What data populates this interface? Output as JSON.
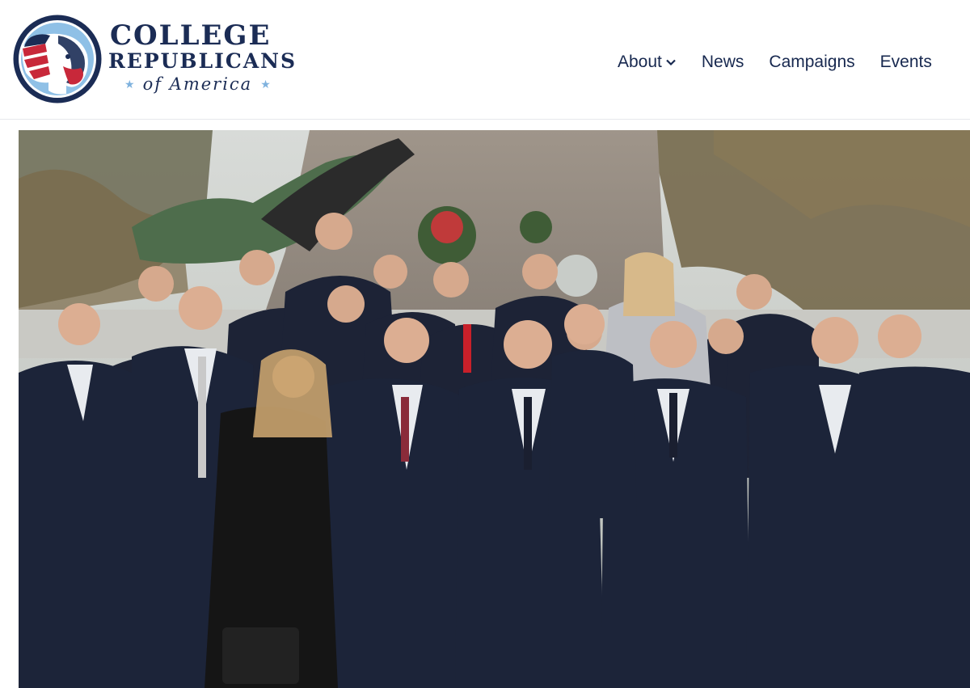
{
  "brand": {
    "line1": "COLLEGE",
    "line2": "REPUBLICANS",
    "line3": "of America",
    "colors": {
      "navy": "#1b2c55",
      "red": "#c8283a",
      "light_blue": "#7fb2de"
    }
  },
  "nav": {
    "items": [
      {
        "label": "About",
        "has_dropdown": true
      },
      {
        "label": "News"
      },
      {
        "label": "Campaigns"
      },
      {
        "label": "Events"
      }
    ]
  },
  "hero": {
    "image_description": "group-photo"
  }
}
